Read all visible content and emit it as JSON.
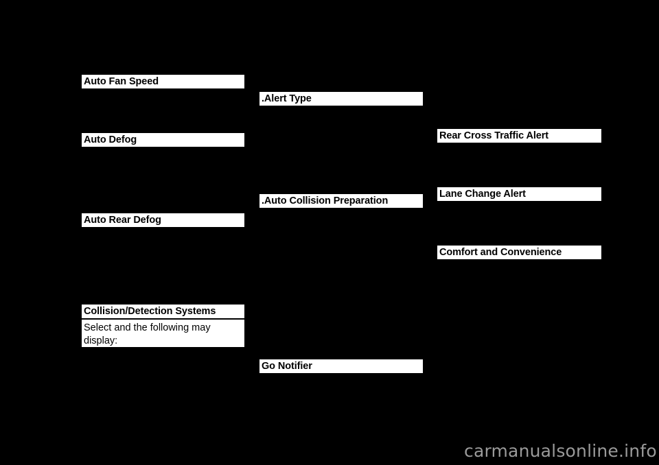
{
  "page": {
    "background_color": "#000000",
    "text_color": "#000000",
    "highlight_color": "#ffffff",
    "watermark_color": "#9a9a9a"
  },
  "columns": {
    "left": {
      "items": [
        {
          "id": "auto-fan-speed",
          "label": "Auto Fan Speed",
          "style": "heading"
        },
        {
          "id": "auto-defog",
          "label": "Auto Defog",
          "style": "heading"
        },
        {
          "id": "auto-rear-defog",
          "label": "Auto Rear Defog",
          "style": "heading"
        },
        {
          "id": "collision-detection-systems",
          "label": "Collision/Detection Systems",
          "style": "heading"
        },
        {
          "id": "collision-detection-body",
          "label": "Select and the following may display:",
          "style": "body"
        }
      ]
    },
    "middle": {
      "items": [
        {
          "id": "alert-type",
          "label": ".Alert Type",
          "style": "heading"
        },
        {
          "id": "auto-collision-preparation",
          "label": ".Auto Collision Preparation",
          "style": "heading"
        },
        {
          "id": "go-notifier",
          "label": "Go Notifier",
          "style": "heading"
        }
      ]
    },
    "right": {
      "items": [
        {
          "id": "rear-cross-traffic-alert",
          "label": "Rear Cross Traffic Alert",
          "style": "heading"
        },
        {
          "id": "lane-change-alert",
          "label": "Lane Change Alert",
          "style": "heading"
        },
        {
          "id": "comfort-and-convenience",
          "label": "Comfort and Convenience",
          "style": "heading"
        }
      ]
    }
  },
  "footer": {
    "watermark": "carmanualsonline.info"
  }
}
